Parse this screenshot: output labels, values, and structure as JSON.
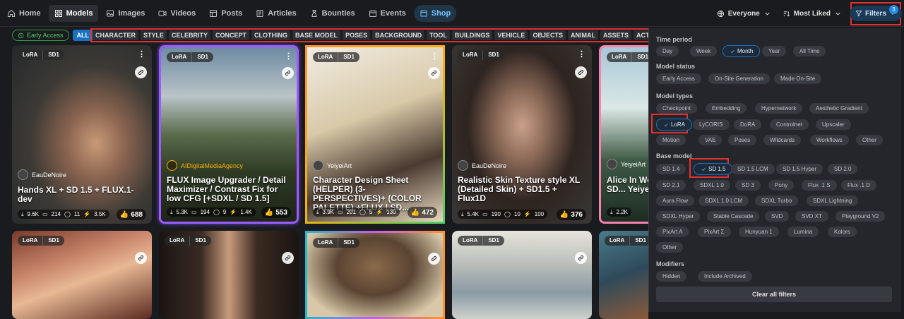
{
  "nav": {
    "items": [
      {
        "label": "Home",
        "icon": "home-icon"
      },
      {
        "label": "Models",
        "icon": "grid-icon",
        "active": true
      },
      {
        "label": "Images",
        "icon": "image-icon"
      },
      {
        "label": "Videos",
        "icon": "video-icon"
      },
      {
        "label": "Posts",
        "icon": "posts-icon"
      },
      {
        "label": "Articles",
        "icon": "article-icon"
      },
      {
        "label": "Bounties",
        "icon": "bounty-icon"
      },
      {
        "label": "Events",
        "icon": "calendar-icon"
      },
      {
        "label": "Shop",
        "icon": "shop-icon"
      }
    ],
    "browsing_level": "Everyone",
    "sort": "Most Liked",
    "filters_label": "Filters",
    "filters_count": "3"
  },
  "categories": {
    "early_access": "Early Access",
    "all": "ALL",
    "items": [
      "CHARACTER",
      "STYLE",
      "CELEBRITY",
      "CONCEPT",
      "CLOTHING",
      "BASE MODEL",
      "POSES",
      "BACKGROUND",
      "TOOL",
      "BUILDINGS",
      "VEHICLE",
      "OBJECTS",
      "ANIMAL",
      "ASSETS",
      "ACTION"
    ]
  },
  "cards": [
    {
      "type": "LoRA",
      "base": "SD1",
      "author": "EauDeNoire",
      "title": "Hands XL + SD 1.5 + FLUX.1-dev",
      "downloads": "9.6K",
      "saves": "214",
      "comments": "11",
      "buzz": "3.5K",
      "likes": "688"
    },
    {
      "type": "LoRA",
      "base": "SD1",
      "author": "AIDigitalMediaAgency",
      "title": "FLUX Image Upgrader / Detail Maximizer / Contrast Fix for low CFG [+SDXL / SD 1.5]",
      "downloads": "5.3K",
      "saves": "194",
      "comments": "9",
      "buzz": "1.4K",
      "likes": "553"
    },
    {
      "type": "LoRA",
      "base": "SD1",
      "author": "YeiyeiArt",
      "title": "Character Design Sheet (HELPER) (3-PERSPECTIVES)+ (COLOR PALETTE) +FLUX | SD...",
      "downloads": "3.9K",
      "saves": "201",
      "comments": "5",
      "buzz": "130",
      "likes": "472"
    },
    {
      "type": "LoRA",
      "base": "SD1",
      "author": "EauDeNoire",
      "title": "Realistic Skin Texture style XL (Detailed Skin) + SD1.5 + Flux1D",
      "downloads": "5.4K",
      "saves": "190",
      "comments": "10",
      "buzz": "100",
      "likes": "376"
    },
    {
      "type": "LoRA",
      "base": "SD1",
      "author": "YeiyeiArt",
      "title": "Alice In Wo... FLUX | SD... YeiyeiArt",
      "downloads": "2.2K",
      "saves": "",
      "comments": "",
      "buzz": "",
      "likes": ""
    },
    {
      "type": "LoRA",
      "base": "SD1"
    },
    {
      "type": "LoRA",
      "base": "SD1"
    },
    {
      "type": "LoRA",
      "base": "SD1"
    },
    {
      "type": "LoRA",
      "base": "SD1"
    },
    {
      "type": "LoRA",
      "base": "SD1"
    }
  ],
  "filters": {
    "time_period": {
      "title": "Time period",
      "options": [
        "Day",
        "Week",
        "Month",
        "Year",
        "All Time"
      ],
      "selected": "Month"
    },
    "model_status": {
      "title": "Model status",
      "options": [
        "Early Access",
        "On-Site Generation",
        "Made On-Site"
      ]
    },
    "model_types": {
      "title": "Model types",
      "options": [
        "Checkpoint",
        "Embedding",
        "Hypernetwork",
        "Aesthetic Gradient",
        "LoRA",
        "LyCORIS",
        "DoRA",
        "Controlnet",
        "Upscaler",
        "Motion",
        "VAE",
        "Poses",
        "Wildcards",
        "Workflows",
        "Other"
      ],
      "selected": "LoRA"
    },
    "base_model": {
      "title": "Base model",
      "options": [
        "SD 1.4",
        "SD 1.5",
        "SD 1.5 LCM",
        "SD 1.5 Hyper",
        "SD 2.0",
        "SD 2.1",
        "SDXL 1.0",
        "SD 3",
        "Pony",
        "Flux .1 S",
        "Flux .1 D",
        "Aura Flow",
        "SDXL 1.0 LCM",
        "SDXL Turbo",
        "SDXL Lightning",
        "SDXL Hyper",
        "Stable Cascade",
        "SVD",
        "SVD XT",
        "Playground V2",
        "PixArt A",
        "PixArt Σ",
        "Hunyuan 1",
        "Lumina",
        "Kolors",
        "Other"
      ],
      "selected": "SD 1.5"
    },
    "modifiers": {
      "title": "Modifiers",
      "options": [
        "Hidden",
        "Include Archived"
      ]
    },
    "clear_label": "Clear all filters"
  }
}
